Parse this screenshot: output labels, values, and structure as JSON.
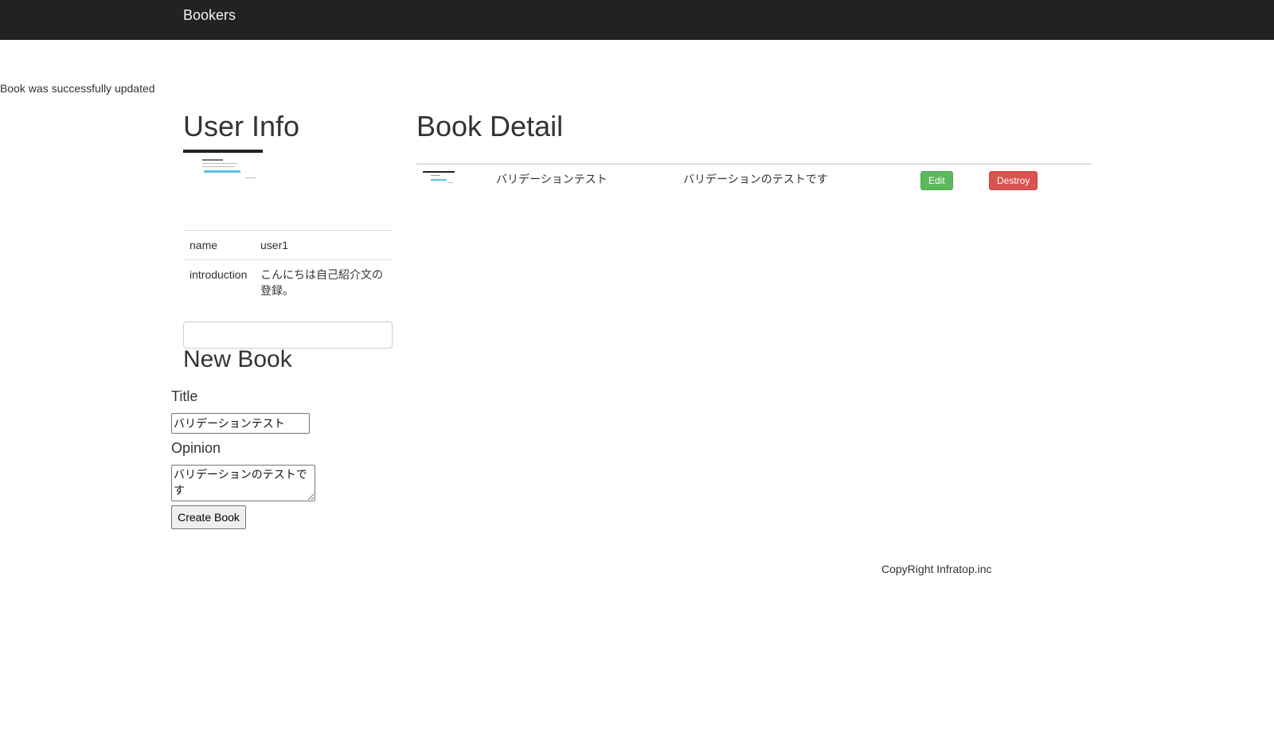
{
  "navbar": {
    "brand": "Bookers"
  },
  "flash": "Book was successfully updated",
  "user_info": {
    "heading": "User Info",
    "rows": [
      {
        "key": "name",
        "value": "user1"
      },
      {
        "key": "introduction",
        "value": "こんにちは自己紹介文の登録。"
      }
    ]
  },
  "new_book": {
    "heading": "New Book",
    "title_label": "Title",
    "title_value": "バリデーションテスト",
    "opinion_label": "Opinion",
    "opinion_value": "バリデーションのテストです",
    "submit_label": "Create Book"
  },
  "book_detail": {
    "heading": "Book Detail",
    "book": {
      "title": "バリデーションテスト",
      "opinion": "バリデーションのテストです",
      "edit_label": "Edit",
      "destroy_label": "Destroy"
    }
  },
  "footer": {
    "text": "CopyRight Infratop.inc"
  },
  "colors": {
    "navbar": "#222222",
    "edit_button": "#5cb85c",
    "destroy_button": "#d9534f"
  }
}
